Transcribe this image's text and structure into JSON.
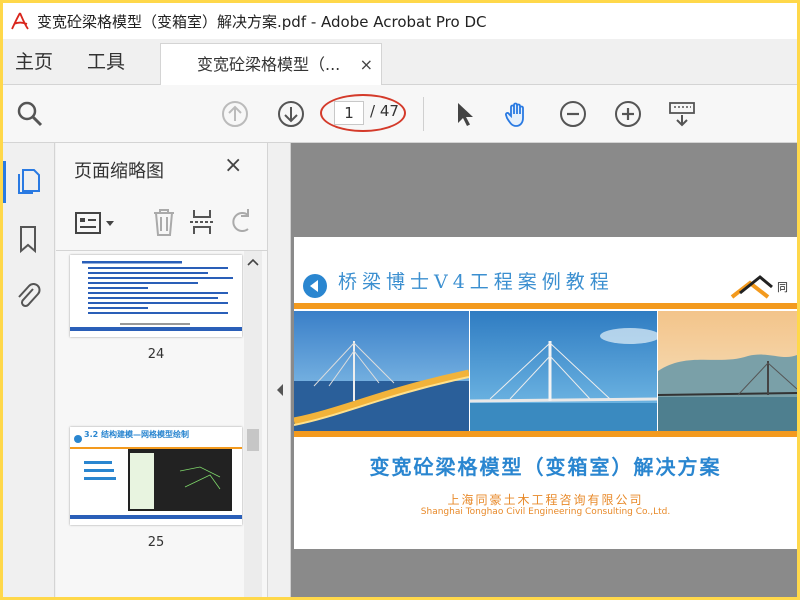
{
  "window": {
    "title": "变宽砼梁格模型（变箱室）解决方案.pdf - Adobe Acrobat Pro DC"
  },
  "tabs": {
    "home": "主页",
    "tools": "工具",
    "document": "变宽砼梁格模型（...",
    "close_icon": "×"
  },
  "toolbar": {
    "current_page": "1",
    "total_pages": "/ 47"
  },
  "panel": {
    "title": "页面缩略图",
    "close_icon": "×",
    "thumbnails": [
      {
        "label": "24"
      },
      {
        "label": "25",
        "heading": "3.2 结构建模—网格模型绘制"
      }
    ]
  },
  "page": {
    "header_title": "桥梁博士V4工程案例教程",
    "logo_text": "同",
    "main_title": "变宽砼梁格模型（变箱室）解决方案",
    "company_cn": "上海同豪土木工程咨询有限公司",
    "company_en": "Shanghai Tonghao Civil Engineering Consulting Co.,Ltd."
  },
  "colors": {
    "accent": "#2a86d0",
    "orange": "#f39a1e",
    "highlight": "#d43a2a"
  }
}
